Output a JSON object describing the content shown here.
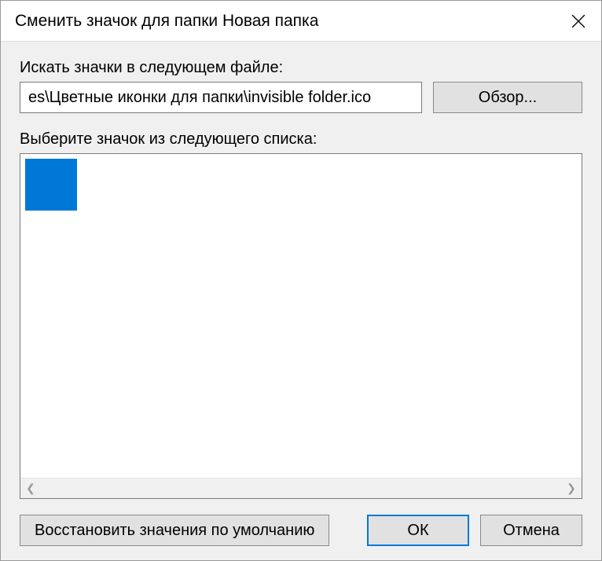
{
  "titlebar": {
    "title": "Сменить значок для папки Новая папка"
  },
  "search_label": "Искать значки в следующем файле:",
  "path_input": {
    "value": "es\\Цветные иконки для папки\\invisible folder.ico"
  },
  "browse_button": "Обзор...",
  "select_label": "Выберите значок из следующего списка:",
  "icons": [
    {
      "color": "#0078d7"
    }
  ],
  "buttons": {
    "restore": "Восстановить значения по умолчанию",
    "ok": "ОК",
    "cancel": "Отмена"
  }
}
